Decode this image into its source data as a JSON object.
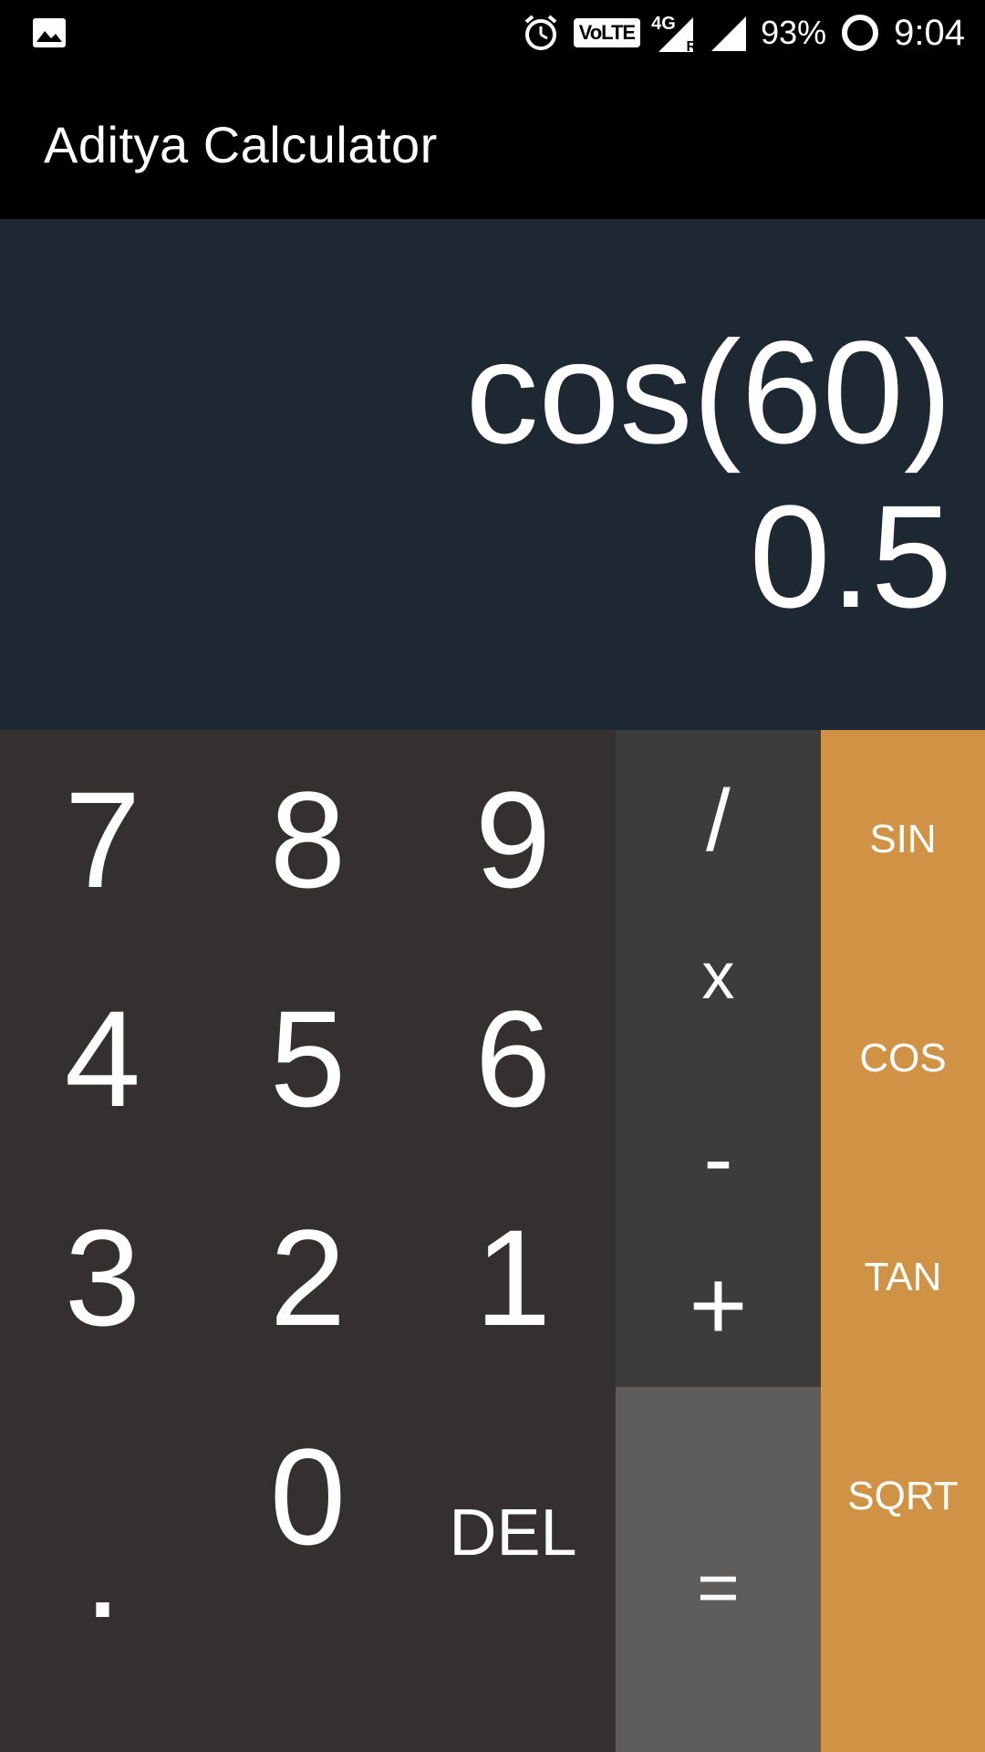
{
  "status_bar": {
    "volte": "VoLTE",
    "network": "4G",
    "roaming": "R",
    "battery": "93%",
    "time": "9:04",
    "icons": [
      "image-icon",
      "alarm-icon",
      "volte-icon",
      "signal-icon",
      "battery-icon"
    ]
  },
  "app_bar": {
    "title": "Aditya Calculator"
  },
  "display": {
    "expression": "cos(60)",
    "result": "0.5"
  },
  "keypad": {
    "digits": {
      "row1": [
        "7",
        "8",
        "9"
      ],
      "row2": [
        "4",
        "5",
        "6"
      ],
      "row3": [
        "3",
        "2",
        "1"
      ],
      "row4": [
        ".",
        "0",
        "DEL"
      ]
    },
    "operators": [
      "/",
      "x",
      "-",
      "+"
    ],
    "equals": "=",
    "scientific": [
      "SIN",
      "COS",
      "TAN",
      "SQRT"
    ]
  },
  "colors": {
    "display_bg": "#1e2833",
    "digits_bg": "#343030",
    "ops_bg": "#3c3c3c",
    "equals_bg": "#5e5d5c",
    "sci_bg": "#d09244"
  }
}
